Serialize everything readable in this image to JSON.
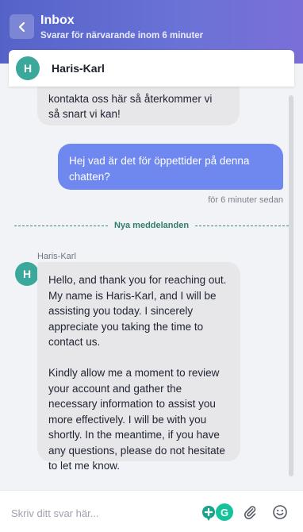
{
  "header": {
    "title": "Inbox",
    "subtitle": "Svarar för närvarande inom 6 minuter",
    "back_icon": "chevron-left-icon"
  },
  "agent": {
    "initial": "H",
    "name": "Haris-Karl"
  },
  "messages": {
    "partial_agent_lines": [
      "kontakta oss här så återkommer vi",
      "så snart vi kan!"
    ],
    "user_message": "Hej vad är det för öppettider på denna chatten?",
    "user_timestamp": "för 6 minuter sedan",
    "new_messages_divider": "Nya meddelanden",
    "agent_sender": "Haris-Karl",
    "agent_initial": "H",
    "agent_paragraphs": [
      "Hello, and thank you for reaching out. My name is Haris-Karl, and I will be assisting you today. I sincerely appreciate you taking the time to contact us.",
      "Kindly allow me a moment to review your account and gather the necessary information to assist you more effectively. I will be with you shortly. In the meantime, if you have any questions, please do not hesitate to let me know."
    ]
  },
  "composer": {
    "placeholder": "Skriv ditt svar här...",
    "value": "",
    "g_label": "G"
  },
  "colors": {
    "header": "#5e69d0",
    "avatar": "#3aa89a",
    "user_bubble": "#6e88f0",
    "agent_bubble": "#e7e7ea",
    "divider": "#2f7f6e"
  }
}
